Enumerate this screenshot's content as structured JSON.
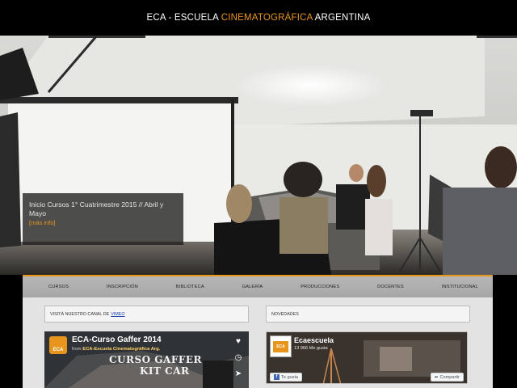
{
  "header": {
    "brand_prefix": "ECA - ESCUELA ",
    "brand_highlight": "CINEMATOGRÁFICA",
    "brand_suffix": " ARGENTINA"
  },
  "hero": {
    "caption_title": "Inicio Cursos 1° Cuatrimestre 2015 // Abril y Mayo",
    "caption_link": "[más info]"
  },
  "nav": {
    "items": [
      "CURSOS",
      "INSCRIPCIÓN",
      "BIBLIOTECA",
      "GALERÍA",
      "PRODUCCIONES",
      "DOCENTES",
      "INSTITUCIONAL"
    ]
  },
  "left_panel": {
    "heading_text": "VISITÁ NUESTRO CANAL DE",
    "heading_link": "VIMEO"
  },
  "right_panel": {
    "heading": "NOVEDADES"
  },
  "video": {
    "logo": "ECA",
    "title": "ECA-Curso Gaffer 2014",
    "from_prefix": "from",
    "from_channel": "ECA-Escuela Cinematográfica Arg.",
    "big_line1": "CURSO GAFFER",
    "big_line2": "KIT CAR"
  },
  "facebook": {
    "avatar_text": "ECA",
    "page_name": "Ecaescuela",
    "likes": "13 966 Me gusta",
    "like_button": "Te gusta",
    "share_button": "Compartir"
  },
  "colors": {
    "accent": "#e8951e",
    "link": "#1a3fb3"
  }
}
